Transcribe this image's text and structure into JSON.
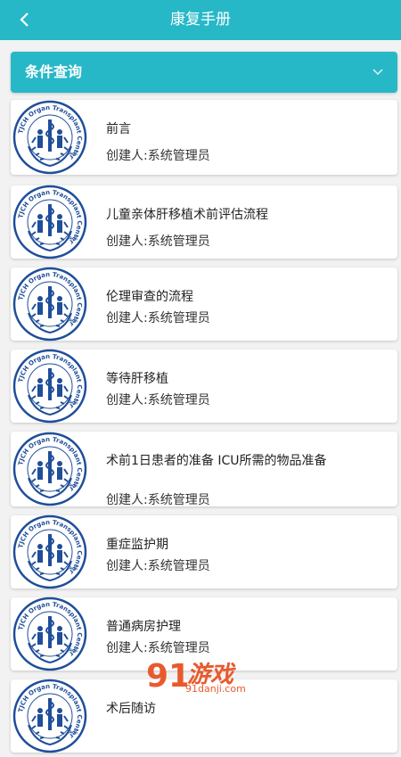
{
  "header": {
    "title": "康复手册",
    "back_icon": "chevron-left-icon"
  },
  "filter": {
    "label": "条件查询",
    "chevron_icon": "chevron-down-icon"
  },
  "logo": {
    "ring_text": "TJCH Organ Transplant Center",
    "seal_text": "净 东"
  },
  "items": [
    {
      "title": "前言",
      "creator": "创建人:系统管理员"
    },
    {
      "title": "儿童亲体肝移植术前评估流程",
      "creator": "创建人:系统管理员"
    },
    {
      "title": "伦理审查的流程",
      "creator": "创建人:系统管理员"
    },
    {
      "title": "等待肝移植",
      "creator": "创建人:系统管理员"
    },
    {
      "title": "术前1日患者的准备 ICU所需的物品准备",
      "creator": "创建人:系统管理员"
    },
    {
      "title": "重症监护期",
      "creator": "创建人:系统管理员"
    },
    {
      "title": "普通病房护理",
      "creator": "创建人:系统管理员"
    },
    {
      "title": "术后随访",
      "creator": ""
    }
  ],
  "watermark": {
    "brand": "游戏",
    "digits": "91",
    "domain": "91danji.com"
  },
  "colors": {
    "accent": "#27b8c8",
    "logo_blue": "#1f4e9a",
    "watermark": "#e85a2e"
  }
}
